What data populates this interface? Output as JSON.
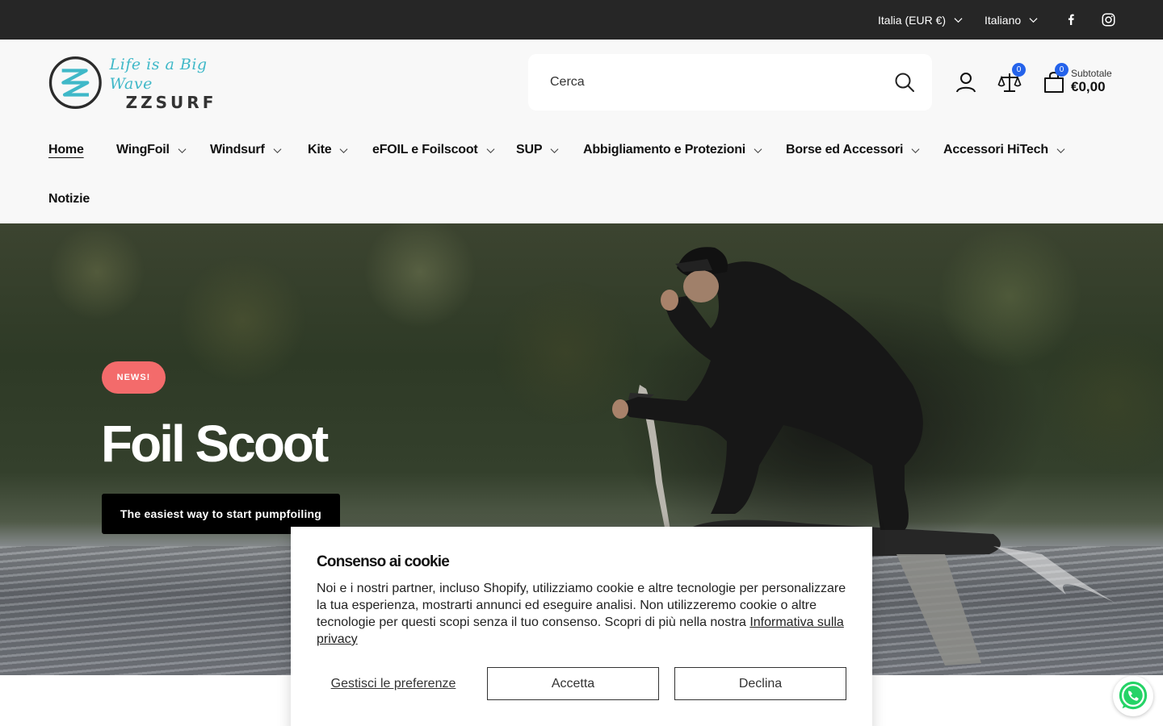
{
  "topbar": {
    "country": "Italia (EUR €)",
    "language": "Italiano",
    "social": [
      "facebook-icon",
      "instagram-icon"
    ]
  },
  "logo": {
    "tagline": "Life is a Big Wave",
    "brand": "ZZSURF"
  },
  "search": {
    "placeholder": "Cerca"
  },
  "header": {
    "compare_count": "0",
    "cart_count": "0",
    "subtotal_label": "Subtotale",
    "subtotal_value": "€0,00"
  },
  "nav": {
    "items": [
      {
        "label": "Home"
      },
      {
        "label": "WingFoil"
      },
      {
        "label": "Windsurf"
      },
      {
        "label": "Kite"
      },
      {
        "label": "eFOIL e Foilscoot"
      },
      {
        "label": "SUP"
      },
      {
        "label": "Abbigliamento e Protezioni"
      },
      {
        "label": "Borse ed Accessori"
      },
      {
        "label": "Accessori HiTech"
      },
      {
        "label": "Notizie"
      }
    ]
  },
  "hero": {
    "badge": "NEWS!",
    "title": "Foil Scoot",
    "button": "The easiest way to start pumpfoiling"
  },
  "cookie": {
    "title": "Consenso ai cookie",
    "text": "Noi e i nostri partner, incluso Shopify, utilizziamo cookie e altre tecnologie per personalizzare la tua esperienza, mostrarti annunci ed eseguire analisi. Non utilizzeremo cookie o altre tecnologie per questi scopi senza il tuo consenso. Scopri di più nella nostra",
    "privacy_link": "Informativa sulla privacy",
    "manage": "Gestisci le preferenze",
    "accept": "Accetta",
    "decline": "Declina"
  },
  "colors": {
    "topbar": "#262626",
    "header_bg": "#f8f8f8",
    "badge_blue": "#2563eb",
    "news_badge": "#f36b6b",
    "logo_accent": "#3fb8c8"
  }
}
